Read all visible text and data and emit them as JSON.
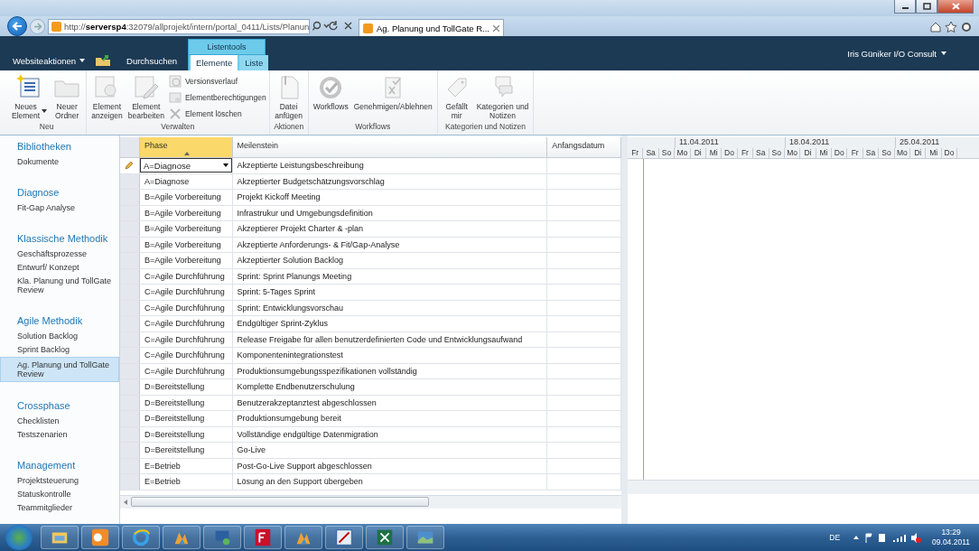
{
  "browser": {
    "address": "http://**serversp4**:32079/allprojekt/intern/portal_0411/Lists/Planun",
    "tab_title": "Ag. Planung und TollGate R..."
  },
  "ribbon": {
    "site_actions": "Websiteaktionen",
    "browse": "Durchsuchen",
    "context_group": "Listentools",
    "user": "Iris Güniker I/O Consult",
    "tabs": [
      {
        "label": "Elemente",
        "selected": true
      },
      {
        "label": "Liste",
        "selected": false
      }
    ],
    "groups": [
      {
        "label": "Neu",
        "buttons": [
          {
            "kind": "large",
            "lines": [
              "Neues",
              "Element"
            ],
            "dropdown": true,
            "disabled": false
          },
          {
            "kind": "large",
            "lines": [
              "Neuer",
              "Ordner"
            ],
            "dropdown": false,
            "disabled": true
          }
        ]
      },
      {
        "label": "Verwalten",
        "buttons": [
          {
            "kind": "large",
            "lines": [
              "Element",
              "anzeigen"
            ],
            "dropdown": false,
            "disabled": true
          },
          {
            "kind": "large",
            "lines": [
              "Element",
              "bearbeiten"
            ],
            "dropdown": false,
            "disabled": true
          },
          {
            "kind": "small",
            "lines": [
              "Versionsverlauf"
            ],
            "dropdown": false,
            "disabled": true
          },
          {
            "kind": "small",
            "lines": [
              "Elementberechtigungen"
            ],
            "dropdown": false,
            "disabled": true
          },
          {
            "kind": "small",
            "lines": [
              "Element löschen"
            ],
            "dropdown": false,
            "disabled": true
          }
        ]
      },
      {
        "label": "Aktionen",
        "buttons": [
          {
            "kind": "large",
            "lines": [
              "Datei",
              "anfügen"
            ],
            "dropdown": false,
            "disabled": true
          }
        ]
      },
      {
        "label": "Workflows",
        "buttons": [
          {
            "kind": "large",
            "lines": [
              "Workflows"
            ],
            "dropdown": false,
            "disabled": true
          },
          {
            "kind": "large",
            "lines": [
              "Genehmigen/Ablehnen"
            ],
            "dropdown": false,
            "disabled": true
          }
        ]
      },
      {
        "label": "Kategorien und Notizen",
        "buttons": [
          {
            "kind": "large",
            "lines": [
              "Gefällt",
              "mir"
            ],
            "dropdown": false,
            "disabled": true
          },
          {
            "kind": "large",
            "lines": [
              "Kategorien und",
              "Notizen"
            ],
            "dropdown": false,
            "disabled": true
          }
        ]
      }
    ]
  },
  "sidebar": {
    "sections": [
      {
        "heading": "Bibliotheken",
        "items": [
          {
            "label": "Dokumente",
            "selected": false
          }
        ]
      },
      {
        "heading": "Diagnose",
        "items": [
          {
            "label": "Fit-Gap Analyse",
            "selected": false
          }
        ]
      },
      {
        "heading": "Klassische Methodik",
        "items": [
          {
            "label": "Geschäftsprozesse",
            "selected": false
          },
          {
            "label": "Entwurf/ Konzept",
            "selected": false
          },
          {
            "label": "Kla. Planung und TollGate Review",
            "selected": false
          }
        ]
      },
      {
        "heading": "Agile Methodik",
        "items": [
          {
            "label": "Solution Backlog",
            "selected": false
          },
          {
            "label": "Sprint Backlog",
            "selected": false
          },
          {
            "label": "Ag. Planung und TollGate Review",
            "selected": true
          }
        ]
      },
      {
        "heading": "Crossphase",
        "items": [
          {
            "label": "Checklisten",
            "selected": false
          },
          {
            "label": "Testszenarien",
            "selected": false
          }
        ]
      },
      {
        "heading": "Management",
        "items": [
          {
            "label": "Projektsteuerung",
            "selected": false
          },
          {
            "label": "Statuskontrolle",
            "selected": false
          },
          {
            "label": "Teammitglieder",
            "selected": false
          }
        ]
      }
    ]
  },
  "table": {
    "columns": [
      {
        "label": "Phase",
        "selected": true
      },
      {
        "label": "Meilenstein",
        "selected": false
      },
      {
        "label": "Anfangsdatum",
        "selected": false
      }
    ],
    "rows": [
      {
        "phase": "A=Diagnose",
        "milestone": "Akzeptierte Leistungsbeschreibung",
        "editing": true
      },
      {
        "phase": "A=Diagnose",
        "milestone": "Akzeptierter Budgetschätzungsvorschlag",
        "editing": false
      },
      {
        "phase": "B=Agile Vorbereitung",
        "milestone": "Projekt Kickoff Meeting",
        "editing": false
      },
      {
        "phase": "B=Agile Vorbereitung",
        "milestone": "Infrastrukur und Umgebungsdefinition",
        "editing": false
      },
      {
        "phase": "B=Agile Vorbereitung",
        "milestone": "Akzeptierer Projekt Charter & -plan",
        "editing": false
      },
      {
        "phase": "B=Agile Vorbereitung",
        "milestone": "Akzeptierte Anforderungs- & Fit/Gap-Analyse",
        "editing": false
      },
      {
        "phase": "B=Agile Vorbereitung",
        "milestone": "Akzeptierter Solution Backlog",
        "editing": false
      },
      {
        "phase": "C=Agile Durchführung",
        "milestone": "Sprint: Sprint Planungs Meeting",
        "editing": false
      },
      {
        "phase": "C=Agile Durchführung",
        "milestone": "Sprint: 5-Tages Sprint",
        "editing": false
      },
      {
        "phase": "C=Agile Durchführung",
        "milestone": "Sprint: Entwicklungsvorschau",
        "editing": false
      },
      {
        "phase": "C=Agile Durchführung",
        "milestone": "Endgültiger Sprint-Zyklus",
        "editing": false
      },
      {
        "phase": "C=Agile Durchführung",
        "milestone": "Release Freigabe für allen benutzerdefinierten Code und Entwicklungsaufwand",
        "editing": false
      },
      {
        "phase": "C=Agile Durchführung",
        "milestone": "Komponentenintegrationstest",
        "editing": false
      },
      {
        "phase": "C=Agile Durchführung",
        "milestone": "Produktionsumgebungsspezifikationen vollständig",
        "editing": false
      },
      {
        "phase": "D=Bereitstellung",
        "milestone": "Komplette Endbenutzerschulung",
        "editing": false
      },
      {
        "phase": "D=Bereitstellung",
        "milestone": "Benutzerakzeptanztest abgeschlossen",
        "editing": false
      },
      {
        "phase": "D=Bereitstellung",
        "milestone": "Produktionsumgebung bereit",
        "editing": false
      },
      {
        "phase": "D=Bereitstellung",
        "milestone": "Vollständige endgültige Datenmigration",
        "editing": false
      },
      {
        "phase": "D=Bereitstellung",
        "milestone": "Go-Live",
        "editing": false
      },
      {
        "phase": "E=Betrieb",
        "milestone": "Post-Go-Live Support abgeschlossen",
        "editing": false
      },
      {
        "phase": "E=Betrieb",
        "milestone": "Lösung an den Support übergeben",
        "editing": false
      }
    ]
  },
  "gantt": {
    "weeks": [
      "11.04.2011",
      "18.04.2011",
      "25.04.2011"
    ],
    "days": [
      "Fr",
      "Sa",
      "So",
      "Mo",
      "Di",
      "Mi",
      "Do",
      "Fr",
      "Sa",
      "So",
      "Mo",
      "Di",
      "Mi",
      "Do",
      "Fr",
      "Sa",
      "So",
      "Mo",
      "Di",
      "Mi",
      "Do"
    ]
  },
  "taskbar": {
    "apps": [
      {
        "kind": "explorer"
      },
      {
        "kind": "outlook"
      },
      {
        "kind": "browser"
      },
      {
        "kind": "chart"
      },
      {
        "kind": "network"
      },
      {
        "kind": "ftp"
      },
      {
        "kind": "chart"
      },
      {
        "kind": "paint"
      },
      {
        "kind": "spreadsheet"
      },
      {
        "kind": "pictures"
      }
    ],
    "language": "DE",
    "time": "13:29",
    "date": "09.04.2011"
  }
}
